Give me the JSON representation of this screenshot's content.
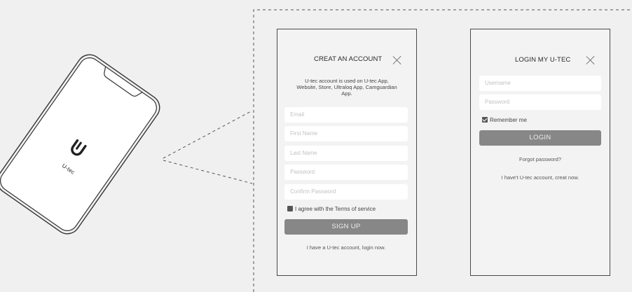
{
  "phone": {
    "logo_text": "U-tec"
  },
  "signup": {
    "title": "CREAT AN ACCOUNT",
    "description": "U-tec account is used on U-tec App, Website, Store, Ultraloq App, Camguardian App.",
    "fields": {
      "email": "Email",
      "first_name": "First Name",
      "last_name": "Last Name",
      "password": "Password",
      "confirm_password": "Confirm Password"
    },
    "terms_label": "I agree with the Terms of service",
    "button_label": "SIGN UP",
    "login_link": "I have a U-tec account, login now."
  },
  "login": {
    "title": "LOGIN MY U-TEC",
    "fields": {
      "username": "Username",
      "password": "Password"
    },
    "remember_label": "Remember me",
    "button_label": "LOGIN",
    "forgot_link": "Forgot password?",
    "create_link": "I have't U-tec account, creat now."
  }
}
